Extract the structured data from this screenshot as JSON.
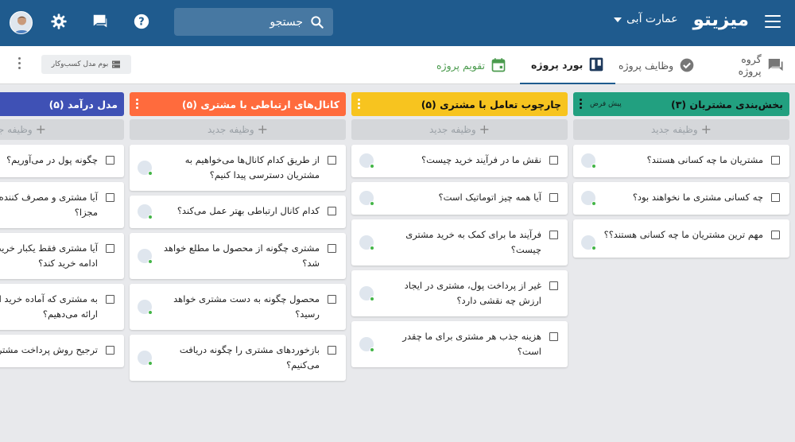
{
  "topbar": {
    "brand": "میزیتو",
    "project": "عمارت آبی",
    "search_placeholder": "جستجو",
    "colors": {
      "bg": "#1f5b8e"
    }
  },
  "subnav": {
    "tabs": [
      {
        "label": "گروه پروژه",
        "icon": "chat-icon"
      },
      {
        "label": "وظایف پروژه",
        "icon": "check-circle-icon"
      },
      {
        "label": "بورد پروژه",
        "icon": "board-icon",
        "active": true
      },
      {
        "label": "تقویم پروژه",
        "icon": "calendar-icon"
      }
    ],
    "bizmodel_label": "بوم مدل کسب‌وکار"
  },
  "board": {
    "add_task_label": "وظیفه جدید",
    "columns": [
      {
        "title": "بخش‌بندی مشتریان (۳)",
        "badge": "پیش فرض",
        "color": "#22a080",
        "cards": [
          "مشتریان ما چه کسانی هستند؟",
          "چه کسانی مشتری ما نخواهند بود؟",
          "مهم ترین مشتریان ما چه کسانی هستند؟؟"
        ]
      },
      {
        "title": "چارچوب تعامل با مشتری (۵)",
        "color": "#f7c41f",
        "cards": [
          "نقش ما در فرآیند خرید چیست؟",
          "آیا همه چیز اتوماتیک است؟",
          "فرآیند ما برای کمک به خرید مشتری چیست؟",
          "غیر از پرداخت پول، مشتری در ایجاد ارزش چه نقشی دارد؟",
          "هزینه جذب هر مشتری برای ما چقدر است؟"
        ]
      },
      {
        "title": "کانال‌های ارتباطی با مشتری (۵)",
        "color": "#ff6b3d",
        "cards": [
          "از طریق کدام کانال‌ها می‌خواهیم به مشتریان دسترسی پیدا کنیم؟",
          "کدام کانال ارتباطی بهتر عمل می‌کند؟",
          "مشتری چگونه از محصول ما مطلع خواهد شد؟",
          "محصول چگونه به دست مشتری خواهد رسید؟",
          "بازخوردهای مشتری را چگونه دریافت می‌کنیم؟"
        ]
      },
      {
        "title": "مدل درآمد (۵)",
        "color": "#3f51b5",
        "cards": [
          "چگونه پول در می‌آوریم؟",
          "آیا مشتری و مصرف کننده یکی هستند یا مجزا؟",
          "آیا مشتری فقط یکبار خرید می‌کند یا در ادامه خرید کند؟",
          "به مشتری که آماده خرید است چه ارزشی ارائه می‌دهیم؟",
          "ترجیح روش پرداخت مشتری"
        ]
      }
    ]
  }
}
